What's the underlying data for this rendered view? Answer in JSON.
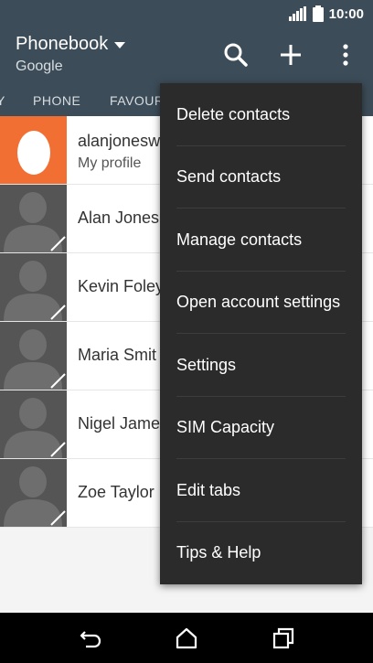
{
  "status_bar": {
    "time": "10:00",
    "icons": [
      "signal-icon",
      "battery-icon"
    ]
  },
  "header": {
    "title": "Phonebook",
    "subtitle": "Google",
    "actions": [
      "search-icon",
      "add-icon",
      "more-icon"
    ]
  },
  "tabs": [
    "Y",
    "PHONE",
    "FAVOUR"
  ],
  "contacts": [
    {
      "name": "alanjonesw",
      "subtitle": "My profile"
    },
    {
      "name": "Alan Jones"
    },
    {
      "name": "Kevin Foley"
    },
    {
      "name": "Maria Smit"
    },
    {
      "name": "Nigel Jame"
    },
    {
      "name": "Zoe Taylor"
    }
  ],
  "menu": [
    "Delete contacts",
    "Send contacts",
    "Manage contacts",
    "Open account settings",
    "Settings",
    "SIM Capacity",
    "Edit tabs",
    "Tips & Help"
  ],
  "nav": [
    "back-icon",
    "home-icon",
    "recents-icon"
  ],
  "colors": {
    "header": "#3c4c58",
    "menu": "#2b2b2b",
    "profile_avatar": "#f26f33"
  }
}
